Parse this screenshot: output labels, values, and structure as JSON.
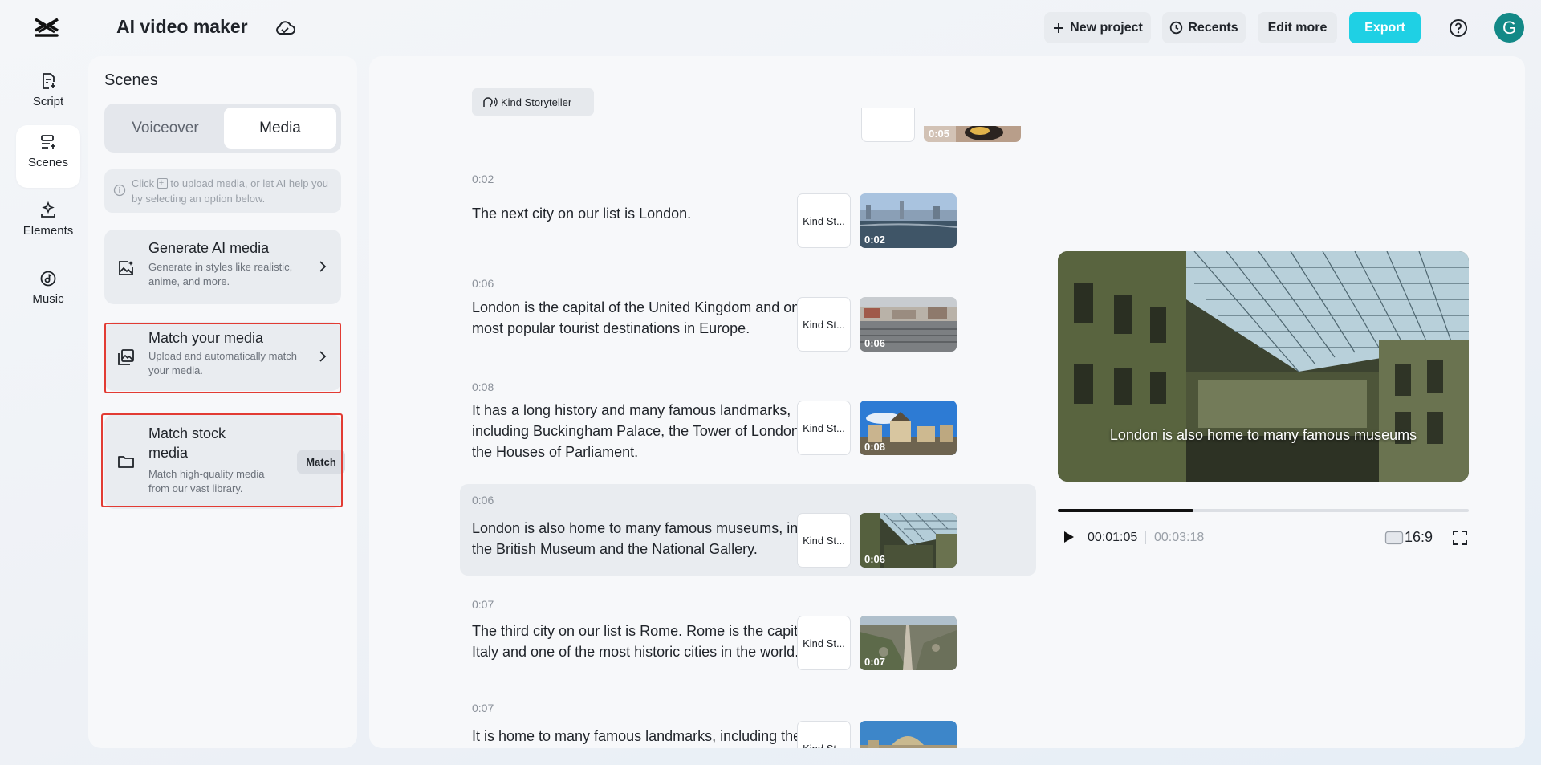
{
  "header": {
    "app_title": "AI video maker",
    "new_project": "New project",
    "recents": "Recents",
    "edit_more": "Edit more",
    "export": "Export",
    "avatar_initial": "G"
  },
  "rail": [
    {
      "label": "Script",
      "icon": "script-icon"
    },
    {
      "label": "Scenes",
      "icon": "scenes-icon",
      "active": true
    },
    {
      "label": "Elements",
      "icon": "elements-icon"
    },
    {
      "label": "Music",
      "icon": "music-icon"
    }
  ],
  "panel": {
    "title": "Scenes",
    "tabs": [
      "Voiceover",
      "Media"
    ],
    "active_tab": "Media",
    "info_pre": "Click",
    "info_post": "to upload media, or let AI help you by selecting an option below.",
    "cards": [
      {
        "title": "Generate AI media",
        "desc": "Generate in styles like realistic, anime, and more."
      },
      {
        "title": "Match your media",
        "desc": "Upload and automatically match your media.",
        "highlighted": true
      },
      {
        "title": "Match stock media",
        "desc": "Match high-quality media from our vast library.",
        "button": "Match",
        "highlighted": true
      }
    ]
  },
  "script": {
    "voice_chip": "Kind Storyteller",
    "top_partial_duration": "0:05",
    "scenes": [
      {
        "time": "0:02",
        "text": "The next city on our list is London.",
        "voice": "Kind St...",
        "duration": "0:02"
      },
      {
        "time": "0:06",
        "text": "London is the capital of the United Kingdom and one of the most popular tourist destinations in Europe.",
        "voice": "Kind St...",
        "duration": "0:06"
      },
      {
        "time": "0:08",
        "text": "It has a long history and many famous landmarks, including Buckingham Palace, the Tower of London and the Houses of Parliament.",
        "voice": "Kind St...",
        "duration": "0:08"
      },
      {
        "time": "0:06",
        "text": "London is also home to many famous museums, including the British Museum and the National Gallery.",
        "voice": "Kind St...",
        "duration": "0:06",
        "active": true
      },
      {
        "time": "0:07",
        "text": "The third city on our list is Rome. Rome is the capital of Italy and one of the most historic cities in the world.",
        "voice": "Kind St...",
        "duration": "0:07"
      },
      {
        "time": "0:07",
        "text": "It is home to many famous landmarks, including the",
        "voice": "Kind St...",
        "duration": ""
      }
    ]
  },
  "player": {
    "caption": "London is also home to many famous museums",
    "current_time": "00:01:05",
    "total_time": "00:03:18",
    "progress_fraction": 0.33,
    "aspect_ratio": "16:9"
  },
  "colors": {
    "accent": "#1fd0e4",
    "avatar": "#138987",
    "highlight": "#e23b33"
  }
}
